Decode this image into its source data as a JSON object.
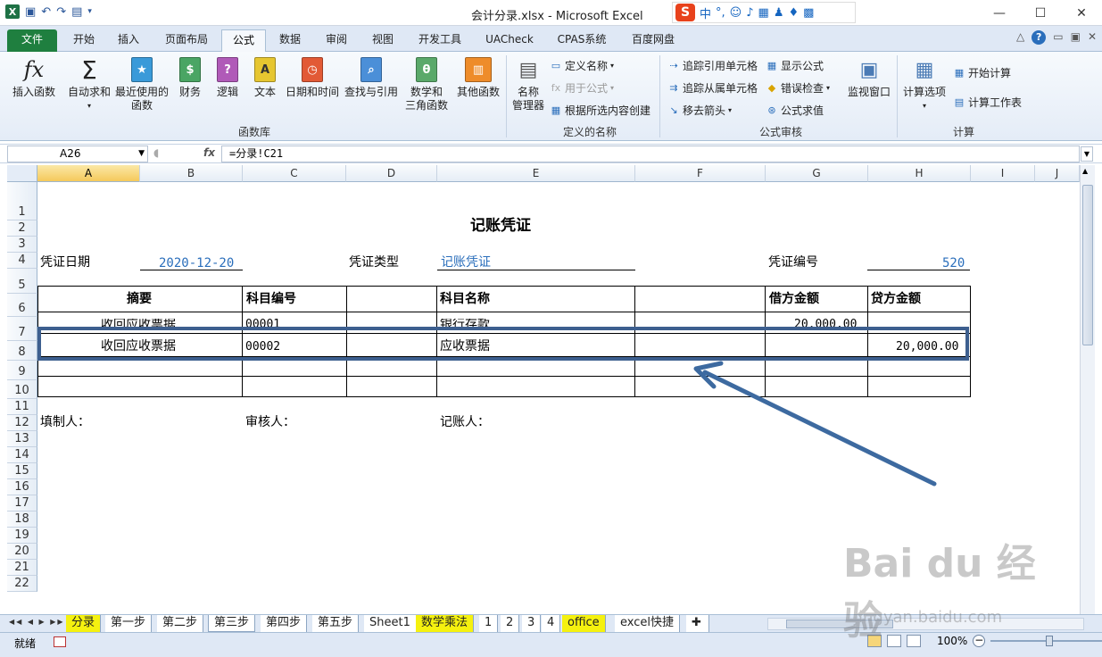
{
  "window": {
    "title": "会计分录.xlsx - Microsoft Excel",
    "ime": [
      "中",
      "°,"
    ]
  },
  "tabs": [
    "文件",
    "开始",
    "插入",
    "页面布局",
    "公式",
    "数据",
    "审阅",
    "视图",
    "开发工具",
    "UACheck",
    "CPAS系统",
    "百度网盘"
  ],
  "ribbon": {
    "func_lib": {
      "insert": "插入函数",
      "autosum": [
        "自动求和"
      ],
      "recent": [
        "最近使用的",
        "函数"
      ],
      "finance": "财务",
      "logic": "逻辑",
      "text": "文本",
      "datetime": "日期和时间",
      "lookup": "查找与引用",
      "math": [
        "数学和",
        "三角函数"
      ],
      "other": "其他函数",
      "group": "函数库"
    },
    "names": {
      "mgr": [
        "名称",
        "管理器"
      ],
      "define": "定义名称",
      "use": "用于公式",
      "create": "根据所选内容创建",
      "group": "定义的名称"
    },
    "audit": {
      "trace_prec": "追踪引用单元格",
      "trace_dep": "追踪从属单元格",
      "remove": "移去箭头",
      "show": "显示公式",
      "check": "错误检查",
      "eval": "公式求值",
      "watch": "监视窗口",
      "group": "公式审核"
    },
    "calc": {
      "options": "计算选项",
      "now": "开始计算",
      "sheet": "计算工作表",
      "group": "计算"
    }
  },
  "formula_bar": {
    "namebox": "A26",
    "fx": "fx",
    "formula": "=分录!C21"
  },
  "columns": [
    "A",
    "B",
    "C",
    "D",
    "E",
    "F",
    "G",
    "H",
    "I",
    "J"
  ],
  "rows": [
    "1",
    "2",
    "3",
    "4",
    "5",
    "6",
    "7",
    "8",
    "9",
    "10",
    "11",
    "12",
    "13",
    "14",
    "15",
    "16",
    "17",
    "18",
    "19",
    "20",
    "21",
    "22"
  ],
  "sheet": {
    "title": "记账凭证",
    "date_label": "凭证日期",
    "date_value": "2020-12-20",
    "type_label": "凭证类型",
    "type_value": "记账凭证",
    "no_label": "凭证编号",
    "no_value": "520",
    "headers": [
      "摘要",
      "科目编号",
      "科目名称",
      "借方金额",
      "贷方金额"
    ],
    "entries": [
      {
        "summary": "收回应收票据",
        "code": "00001",
        "name": "银行存款",
        "debit": "20,000.00",
        "credit": ""
      },
      {
        "summary": "收回应收票据",
        "code": "00002",
        "name": "应收票据",
        "debit": "",
        "credit": "20,000.00"
      }
    ],
    "preparer": "填制人：",
    "reviewer": "审核人：",
    "bookkeeper": "记账人："
  },
  "sheet_tabs": [
    "分录",
    "第一步",
    "第二步",
    "第三步",
    "第四步",
    "第五步",
    "Sheet1",
    "数学乘法",
    "1",
    "2",
    "3",
    "4",
    "office",
    "excel快捷"
  ],
  "active_sheet": "第三步",
  "status": {
    "ready": "就绪",
    "zoom": "100%"
  },
  "watermark": {
    "brand": "Bai du 经验",
    "url": "jingyan.baidu.com"
  },
  "colors": {
    "accent_blue": "#2a6ebb",
    "highlight_box": "#3d5f8f",
    "sheet_tab_yellow": "#f5f10f",
    "file_tab": "#1f7f3f"
  }
}
